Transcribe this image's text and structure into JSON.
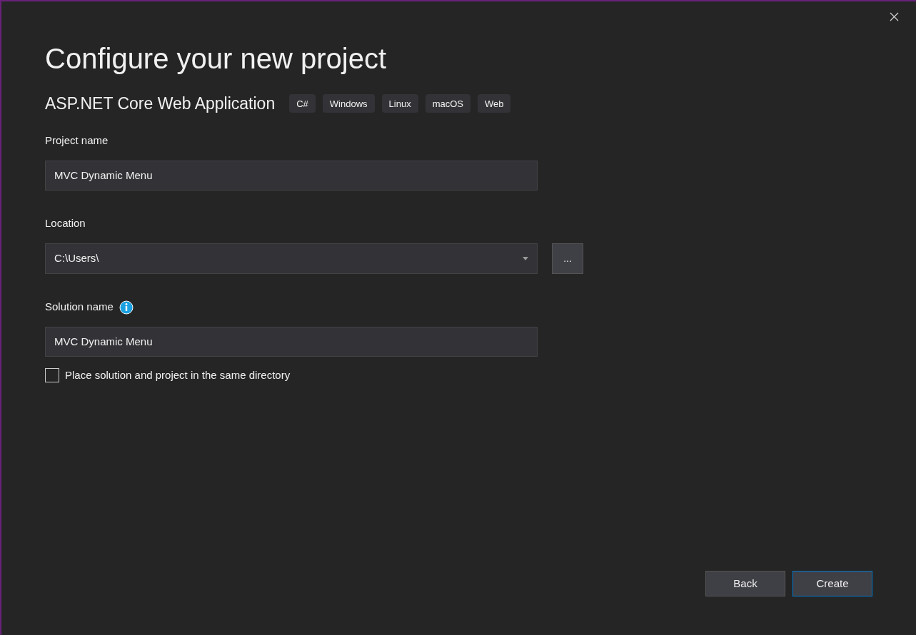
{
  "title": "Configure your new project",
  "template": {
    "name": "ASP.NET Core Web Application",
    "tags": [
      "C#",
      "Windows",
      "Linux",
      "macOS",
      "Web"
    ]
  },
  "fields": [
    {
      "kind": "text",
      "label": "Project name",
      "value": "MVC Dynamic Menu"
    },
    {
      "kind": "dropdown",
      "label": "Location",
      "value": "C:\\Users\\",
      "browse_label": "..."
    },
    {
      "kind": "text",
      "label": "Solution name",
      "value": "MVC Dynamic Menu",
      "info": true
    }
  ],
  "same_directory": {
    "label": "Place solution and project in the same directory",
    "checked": false
  },
  "buttons": [
    {
      "label": "Back",
      "focused": false
    },
    {
      "label": "Create",
      "focused": true
    }
  ]
}
